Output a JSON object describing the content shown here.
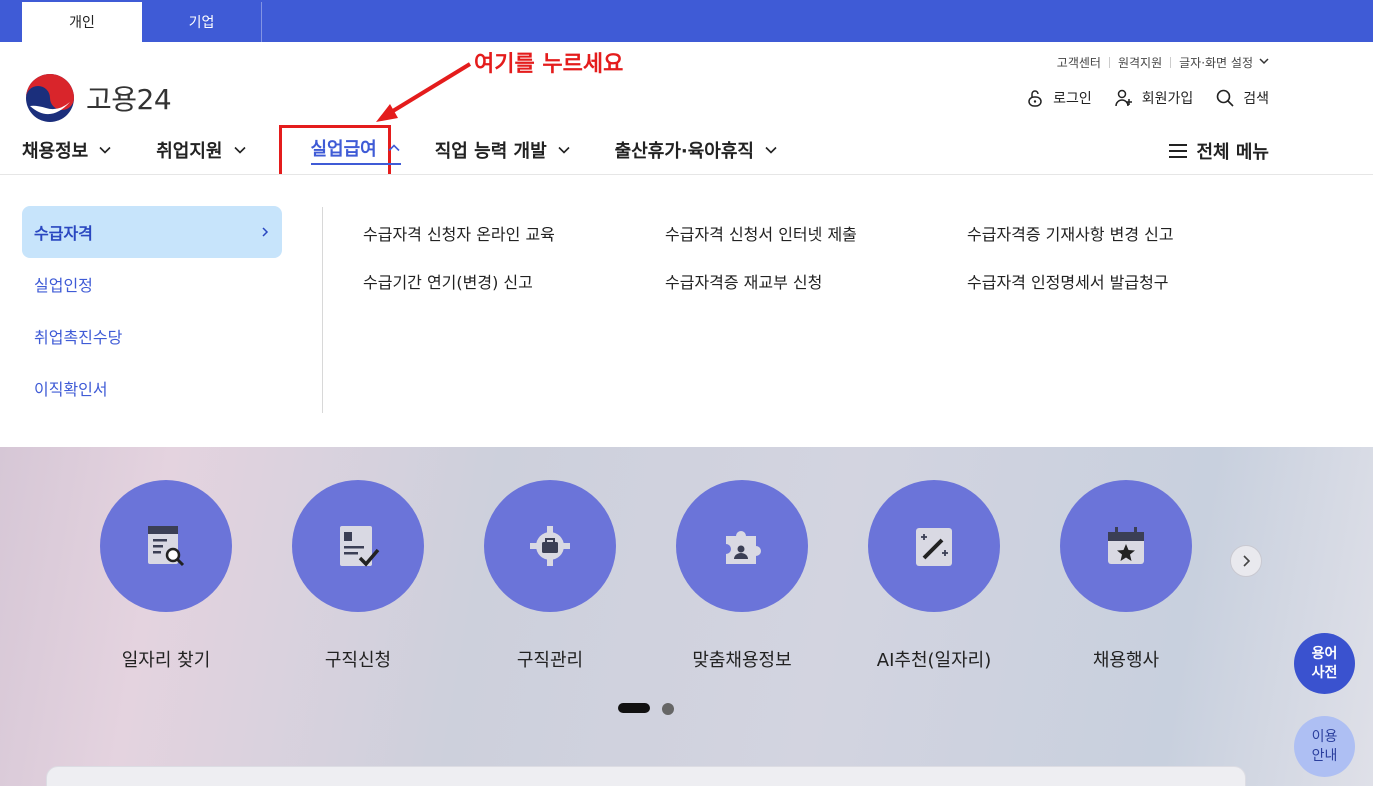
{
  "top_tabs": [
    "개인",
    "기업"
  ],
  "logo_text": "고용24",
  "utility_links": [
    "고객센터",
    "원격지원",
    "글자·화면 설정"
  ],
  "actions": {
    "login": "로그인",
    "signup": "회원가입",
    "search": "검색"
  },
  "annotation": "여기를 누르세요",
  "gnb": [
    "채용정보",
    "취업지원",
    "실업급여",
    "직업 능력 개발",
    "출산휴가·육아휴직"
  ],
  "all_menu": "전체 메뉴",
  "side_menu": [
    "수급자격",
    "실업인정",
    "취업촉진수당",
    "이직확인서"
  ],
  "sub_menu": {
    "row1": [
      "수급자격 신청자 온라인 교육",
      "수급자격 신청서 인터넷 제출",
      "수급자격증 기재사항 변경 신고"
    ],
    "row2": [
      "수급기간 연기(변경) 신고",
      "수급자격증 재교부 신청",
      "수급자격 인정명세서 발급청구"
    ]
  },
  "quick_menu": [
    "일자리 찾기",
    "구직신청",
    "구직관리",
    "맞춤채용정보",
    "AI추천(일자리)",
    "채용행사"
  ],
  "fab": {
    "glossary_1": "용어",
    "glossary_2": "사전",
    "guide_1": "이용",
    "guide_2": "안내"
  },
  "colors": {
    "brand": "#3f5bd6",
    "highlight": "#e41c1c",
    "circle": "#6b74d9"
  }
}
